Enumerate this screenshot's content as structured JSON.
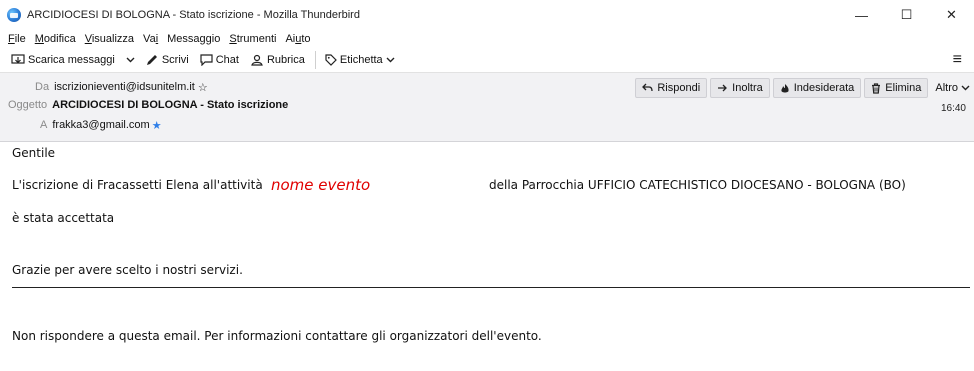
{
  "window": {
    "title": "ARCIDIOCESI DI BOLOGNA - Stato iscrizione - Mozilla Thunderbird",
    "minimize": "—",
    "maximize": "☐",
    "close": "✕"
  },
  "menu": {
    "items": [
      {
        "acc": "F",
        "rest": "ile"
      },
      {
        "acc": "M",
        "rest": "odifica"
      },
      {
        "acc": "V",
        "rest": "isualizza"
      },
      {
        "pre": "Va",
        "acc": "i",
        "rest": ""
      },
      {
        "pre": "Messa",
        "acc": "g",
        "rest": "gio"
      },
      {
        "acc": "S",
        "rest": "trumenti"
      },
      {
        "pre": "Ai",
        "acc": "u",
        "rest": "to"
      }
    ]
  },
  "toolbar": {
    "get_messages": "Scarica messaggi",
    "write": "Scrivi",
    "chat": "Chat",
    "address_book": "Rubrica",
    "tag": "Etichetta",
    "menu_icon": "≡"
  },
  "header": {
    "from_label": "Da",
    "from_value": "iscrizionieventi@idsunitelm.it",
    "subject_label": "Oggetto",
    "subject_value": "ARCIDIOCESI DI BOLOGNA - Stato iscrizione",
    "to_label": "A",
    "to_value": "frakka3@gmail.com",
    "date": "16:40",
    "actions": {
      "reply": "Rispondi",
      "forward": "Inoltra",
      "junk": "Indesiderata",
      "delete": "Elimina",
      "more": "Altro"
    }
  },
  "body": {
    "greeting": "Gentile",
    "enrollment_prefix": "L'iscrizione di Fracassetti Elena all'attività",
    "event_name": "nome evento",
    "parish": "della Parrocchia UFFICIO CATECHISTICO DIOCESANO - BOLOGNA (BO)",
    "accepted": "è stata accettata",
    "thanks": "Grazie per avere scelto i nostri servizi.",
    "footer_note": "Non rispondere a questa email. Per informazioni contattare gli organizzatori dell'evento."
  },
  "colors": {
    "event_name": "#e00000",
    "header_bg": "#f2f2f4",
    "star_blue": "#2f7fe8"
  }
}
